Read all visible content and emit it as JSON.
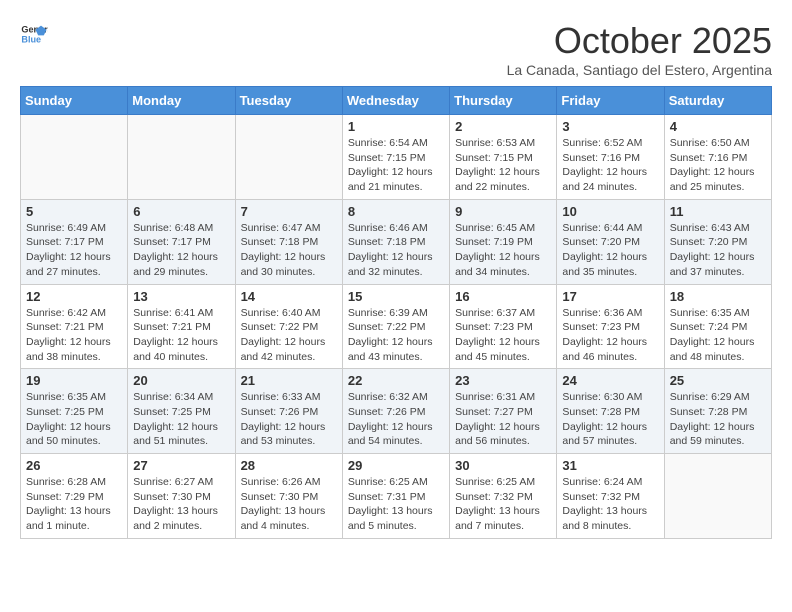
{
  "header": {
    "logo_line1": "General",
    "logo_line2": "Blue",
    "month_title": "October 2025",
    "location": "La Canada, Santiago del Estero, Argentina"
  },
  "weekdays": [
    "Sunday",
    "Monday",
    "Tuesday",
    "Wednesday",
    "Thursday",
    "Friday",
    "Saturday"
  ],
  "weeks": [
    [
      {
        "day": "",
        "sunrise": "",
        "sunset": "",
        "daylight": ""
      },
      {
        "day": "",
        "sunrise": "",
        "sunset": "",
        "daylight": ""
      },
      {
        "day": "",
        "sunrise": "",
        "sunset": "",
        "daylight": ""
      },
      {
        "day": "1",
        "sunrise": "Sunrise: 6:54 AM",
        "sunset": "Sunset: 7:15 PM",
        "daylight": "Daylight: 12 hours and 21 minutes."
      },
      {
        "day": "2",
        "sunrise": "Sunrise: 6:53 AM",
        "sunset": "Sunset: 7:15 PM",
        "daylight": "Daylight: 12 hours and 22 minutes."
      },
      {
        "day": "3",
        "sunrise": "Sunrise: 6:52 AM",
        "sunset": "Sunset: 7:16 PM",
        "daylight": "Daylight: 12 hours and 24 minutes."
      },
      {
        "day": "4",
        "sunrise": "Sunrise: 6:50 AM",
        "sunset": "Sunset: 7:16 PM",
        "daylight": "Daylight: 12 hours and 25 minutes."
      }
    ],
    [
      {
        "day": "5",
        "sunrise": "Sunrise: 6:49 AM",
        "sunset": "Sunset: 7:17 PM",
        "daylight": "Daylight: 12 hours and 27 minutes."
      },
      {
        "day": "6",
        "sunrise": "Sunrise: 6:48 AM",
        "sunset": "Sunset: 7:17 PM",
        "daylight": "Daylight: 12 hours and 29 minutes."
      },
      {
        "day": "7",
        "sunrise": "Sunrise: 6:47 AM",
        "sunset": "Sunset: 7:18 PM",
        "daylight": "Daylight: 12 hours and 30 minutes."
      },
      {
        "day": "8",
        "sunrise": "Sunrise: 6:46 AM",
        "sunset": "Sunset: 7:18 PM",
        "daylight": "Daylight: 12 hours and 32 minutes."
      },
      {
        "day": "9",
        "sunrise": "Sunrise: 6:45 AM",
        "sunset": "Sunset: 7:19 PM",
        "daylight": "Daylight: 12 hours and 34 minutes."
      },
      {
        "day": "10",
        "sunrise": "Sunrise: 6:44 AM",
        "sunset": "Sunset: 7:20 PM",
        "daylight": "Daylight: 12 hours and 35 minutes."
      },
      {
        "day": "11",
        "sunrise": "Sunrise: 6:43 AM",
        "sunset": "Sunset: 7:20 PM",
        "daylight": "Daylight: 12 hours and 37 minutes."
      }
    ],
    [
      {
        "day": "12",
        "sunrise": "Sunrise: 6:42 AM",
        "sunset": "Sunset: 7:21 PM",
        "daylight": "Daylight: 12 hours and 38 minutes."
      },
      {
        "day": "13",
        "sunrise": "Sunrise: 6:41 AM",
        "sunset": "Sunset: 7:21 PM",
        "daylight": "Daylight: 12 hours and 40 minutes."
      },
      {
        "day": "14",
        "sunrise": "Sunrise: 6:40 AM",
        "sunset": "Sunset: 7:22 PM",
        "daylight": "Daylight: 12 hours and 42 minutes."
      },
      {
        "day": "15",
        "sunrise": "Sunrise: 6:39 AM",
        "sunset": "Sunset: 7:22 PM",
        "daylight": "Daylight: 12 hours and 43 minutes."
      },
      {
        "day": "16",
        "sunrise": "Sunrise: 6:37 AM",
        "sunset": "Sunset: 7:23 PM",
        "daylight": "Daylight: 12 hours and 45 minutes."
      },
      {
        "day": "17",
        "sunrise": "Sunrise: 6:36 AM",
        "sunset": "Sunset: 7:23 PM",
        "daylight": "Daylight: 12 hours and 46 minutes."
      },
      {
        "day": "18",
        "sunrise": "Sunrise: 6:35 AM",
        "sunset": "Sunset: 7:24 PM",
        "daylight": "Daylight: 12 hours and 48 minutes."
      }
    ],
    [
      {
        "day": "19",
        "sunrise": "Sunrise: 6:35 AM",
        "sunset": "Sunset: 7:25 PM",
        "daylight": "Daylight: 12 hours and 50 minutes."
      },
      {
        "day": "20",
        "sunrise": "Sunrise: 6:34 AM",
        "sunset": "Sunset: 7:25 PM",
        "daylight": "Daylight: 12 hours and 51 minutes."
      },
      {
        "day": "21",
        "sunrise": "Sunrise: 6:33 AM",
        "sunset": "Sunset: 7:26 PM",
        "daylight": "Daylight: 12 hours and 53 minutes."
      },
      {
        "day": "22",
        "sunrise": "Sunrise: 6:32 AM",
        "sunset": "Sunset: 7:26 PM",
        "daylight": "Daylight: 12 hours and 54 minutes."
      },
      {
        "day": "23",
        "sunrise": "Sunrise: 6:31 AM",
        "sunset": "Sunset: 7:27 PM",
        "daylight": "Daylight: 12 hours and 56 minutes."
      },
      {
        "day": "24",
        "sunrise": "Sunrise: 6:30 AM",
        "sunset": "Sunset: 7:28 PM",
        "daylight": "Daylight: 12 hours and 57 minutes."
      },
      {
        "day": "25",
        "sunrise": "Sunrise: 6:29 AM",
        "sunset": "Sunset: 7:28 PM",
        "daylight": "Daylight: 12 hours and 59 minutes."
      }
    ],
    [
      {
        "day": "26",
        "sunrise": "Sunrise: 6:28 AM",
        "sunset": "Sunset: 7:29 PM",
        "daylight": "Daylight: 13 hours and 1 minute."
      },
      {
        "day": "27",
        "sunrise": "Sunrise: 6:27 AM",
        "sunset": "Sunset: 7:30 PM",
        "daylight": "Daylight: 13 hours and 2 minutes."
      },
      {
        "day": "28",
        "sunrise": "Sunrise: 6:26 AM",
        "sunset": "Sunset: 7:30 PM",
        "daylight": "Daylight: 13 hours and 4 minutes."
      },
      {
        "day": "29",
        "sunrise": "Sunrise: 6:25 AM",
        "sunset": "Sunset: 7:31 PM",
        "daylight": "Daylight: 13 hours and 5 minutes."
      },
      {
        "day": "30",
        "sunrise": "Sunrise: 6:25 AM",
        "sunset": "Sunset: 7:32 PM",
        "daylight": "Daylight: 13 hours and 7 minutes."
      },
      {
        "day": "31",
        "sunrise": "Sunrise: 6:24 AM",
        "sunset": "Sunset: 7:32 PM",
        "daylight": "Daylight: 13 hours and 8 minutes."
      },
      {
        "day": "",
        "sunrise": "",
        "sunset": "",
        "daylight": ""
      }
    ]
  ]
}
